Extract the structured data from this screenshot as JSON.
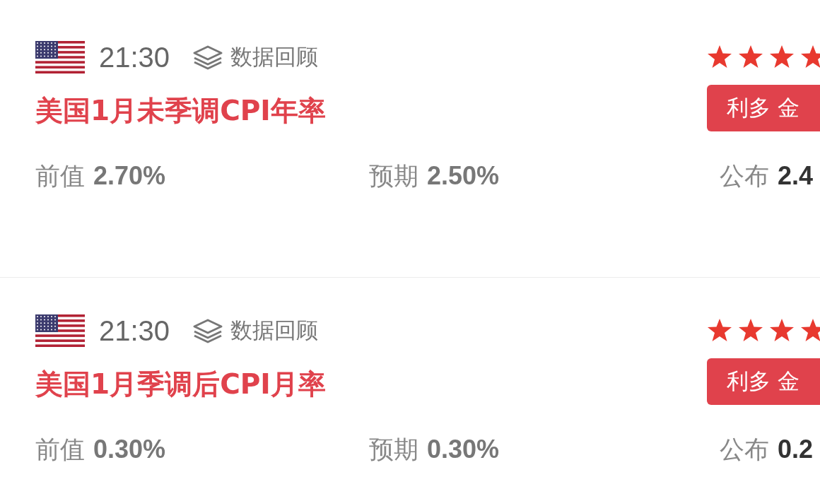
{
  "events": [
    {
      "time": "21:30",
      "review": "数据回顾",
      "stars": 4,
      "title": "美国1月未季调CPI年率",
      "badge": "利多 金",
      "previous_label": "前值",
      "previous": "2.70%",
      "forecast_label": "预期",
      "forecast": "2.50%",
      "actual_label": "公布",
      "actual": "2.4"
    },
    {
      "time": "21:30",
      "review": "数据回顾",
      "stars": 4,
      "title": "美国1月季调后CPI月率",
      "badge": "利多 金",
      "previous_label": "前值",
      "previous": "0.30%",
      "forecast_label": "预期",
      "forecast": "0.30%",
      "actual_label": "公布",
      "actual": "0.2"
    }
  ]
}
